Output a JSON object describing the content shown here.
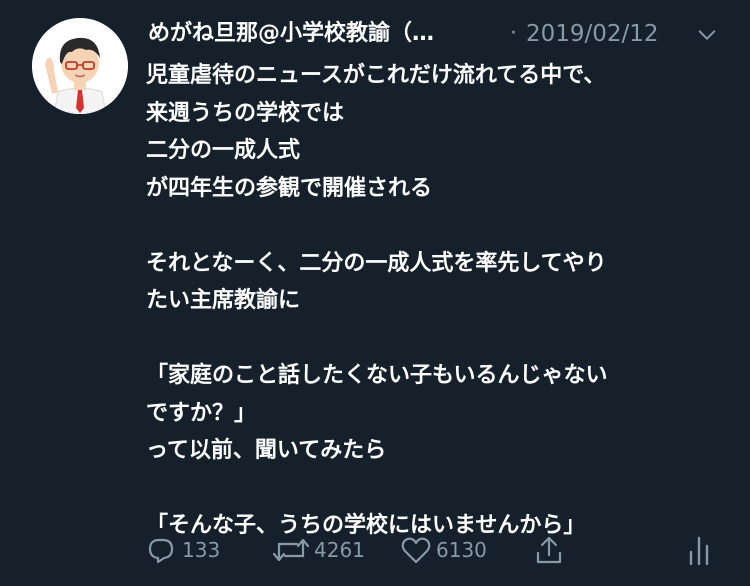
{
  "tweet": {
    "author_name": "めがね旦那@小学校教諭（…",
    "separator": "·",
    "date": "2019/02/12",
    "body_lines": [
      "児童虐待のニュースがこれだけ流れてる中で、",
      "来週うちの学校では",
      "二分の一成人式",
      "が四年生の参観で開催される",
      "",
      "それとなーく、二分の一成人式を率先してやり",
      "たい主席教諭に",
      "",
      "「家庭のこと話したくない子もいるんじゃない",
      "ですか？」",
      "って以前、聞いてみたら",
      "",
      "「そんな子、うちの学校にはいませんから」"
    ],
    "actions": {
      "reply_count": "133",
      "retweet_count": "4261",
      "like_count": "6130"
    }
  },
  "colors": {
    "background": "#15202b",
    "text": "#ffffff",
    "muted": "#8899a6"
  },
  "icons": [
    "avatar-illustration",
    "chevron-down-icon",
    "reply-icon",
    "retweet-icon",
    "like-icon",
    "share-icon",
    "analytics-icon"
  ]
}
